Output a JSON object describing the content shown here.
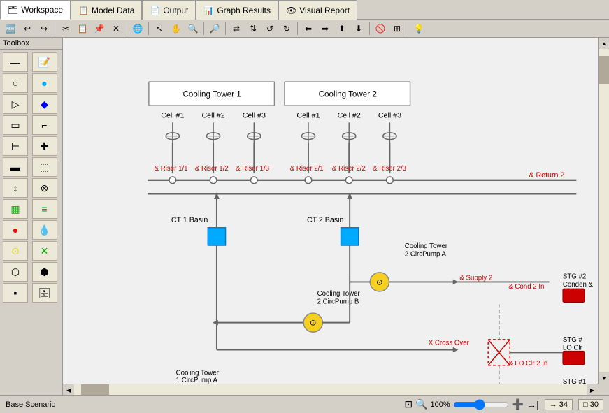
{
  "tabs": [
    {
      "id": "workspace",
      "label": "Workspace",
      "icon": "🗂",
      "active": true
    },
    {
      "id": "model-data",
      "label": "Model Data",
      "icon": "📋",
      "active": false
    },
    {
      "id": "output",
      "label": "Output",
      "icon": "📄",
      "active": false
    },
    {
      "id": "graph-results",
      "label": "Graph Results",
      "icon": "📊",
      "active": false
    },
    {
      "id": "visual-report",
      "label": "Visual Report",
      "icon": "👁",
      "active": false
    }
  ],
  "toolbox": {
    "title": "Toolbox",
    "items": [
      {
        "icon": "—",
        "name": "pipe"
      },
      {
        "icon": "📝",
        "name": "label"
      },
      {
        "icon": "◯",
        "name": "circle"
      },
      {
        "icon": "🔵",
        "name": "filled-circle"
      },
      {
        "icon": "▷",
        "name": "triangle"
      },
      {
        "icon": "🔷",
        "name": "diamond"
      },
      {
        "icon": "⬜",
        "name": "rect"
      },
      {
        "icon": "📐",
        "name": "corner"
      },
      {
        "icon": "⊢",
        "name": "tee"
      },
      {
        "icon": "✚",
        "name": "cross"
      },
      {
        "icon": "⬛",
        "name": "block"
      },
      {
        "icon": "🔲",
        "name": "dashed-rect"
      },
      {
        "icon": "↕",
        "name": "vert"
      },
      {
        "icon": "⊗",
        "name": "x-cross"
      },
      {
        "icon": "⊞",
        "name": "grid"
      },
      {
        "icon": "≡",
        "name": "three-lines"
      },
      {
        "icon": "🔴",
        "name": "red-circle"
      },
      {
        "icon": "💧",
        "name": "drop"
      },
      {
        "icon": "⊙",
        "name": "pump"
      },
      {
        "icon": "✕",
        "name": "valve"
      },
      {
        "icon": "⬡",
        "name": "hex"
      },
      {
        "icon": "⬢",
        "name": "hex-fill"
      },
      {
        "icon": "📦",
        "name": "box"
      },
      {
        "icon": "🗄",
        "name": "shelf"
      }
    ]
  },
  "diagram": {
    "cooling_tower_1": {
      "label": "Cooling Tower 1",
      "cells": [
        "Cell #1",
        "Cell #2",
        "Cell #3"
      ],
      "risers": [
        "& Riser 1/1",
        "& Riser 1/2",
        "& Riser 1/3"
      ],
      "basin": "CT 1 Basin",
      "pump_a": "Cooling Tower\n1 CircPump A"
    },
    "cooling_tower_2": {
      "label": "Cooling Tower 2",
      "cells": [
        "Cell #1",
        "Cell #2",
        "Cell #3"
      ],
      "risers": [
        "& Riser 2/1",
        "& Riser 2/2",
        "& Riser 2/3"
      ],
      "basin": "CT 2 Basin",
      "pump_a": "Cooling Tower\n2 CircPump A",
      "pump_b": "Cooling Tower\n2 CircPump B"
    },
    "labels": {
      "return2": "& Return 2",
      "supply2": "& Supply 2",
      "cond2in": "& Cond 2 In",
      "lo_clr_2in": "& LO Clr 2 In",
      "cross_over": "X Cross Over",
      "stg2_conden": "STG #2\nConden &",
      "stg_lo_clr": "STG #\nLO Clr",
      "stg1": "STG #1"
    }
  },
  "status": {
    "scenario": "Base Scenario",
    "zoom": "100%",
    "coord_x": "34",
    "coord_y": "30"
  }
}
